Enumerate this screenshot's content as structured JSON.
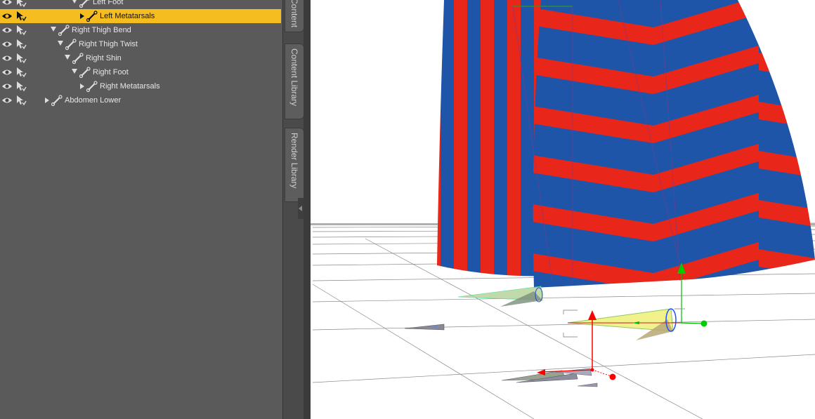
{
  "scene_tree": {
    "rows": [
      {
        "label": "Left Foot",
        "expand": "down",
        "selected": false
      },
      {
        "label": "Left Metatarsals",
        "expand": "right",
        "selected": true
      },
      {
        "label": "Right Thigh Bend",
        "expand": "down",
        "selected": false
      },
      {
        "label": "Right Thigh Twist",
        "expand": "down",
        "selected": false
      },
      {
        "label": "Right Shin",
        "expand": "down",
        "selected": false
      },
      {
        "label": "Right Foot",
        "expand": "down",
        "selected": false
      },
      {
        "label": "Right Metatarsals",
        "expand": "right",
        "selected": false
      },
      {
        "label": "Abdomen Lower",
        "expand": "right",
        "selected": false
      }
    ]
  },
  "side_tabs": {
    "content": "Content",
    "content_library": "Content Library",
    "render_library": "Render Library"
  },
  "colors": {
    "selection": "#f5bd1f",
    "panel_bg": "#5a5a5a",
    "stripe_red": "#e8261a",
    "stripe_blue": "#1f55a8",
    "gizmo_x": "#ff0000",
    "gizmo_y": "#00cc00",
    "gizmo_z": "#1e50ff"
  }
}
